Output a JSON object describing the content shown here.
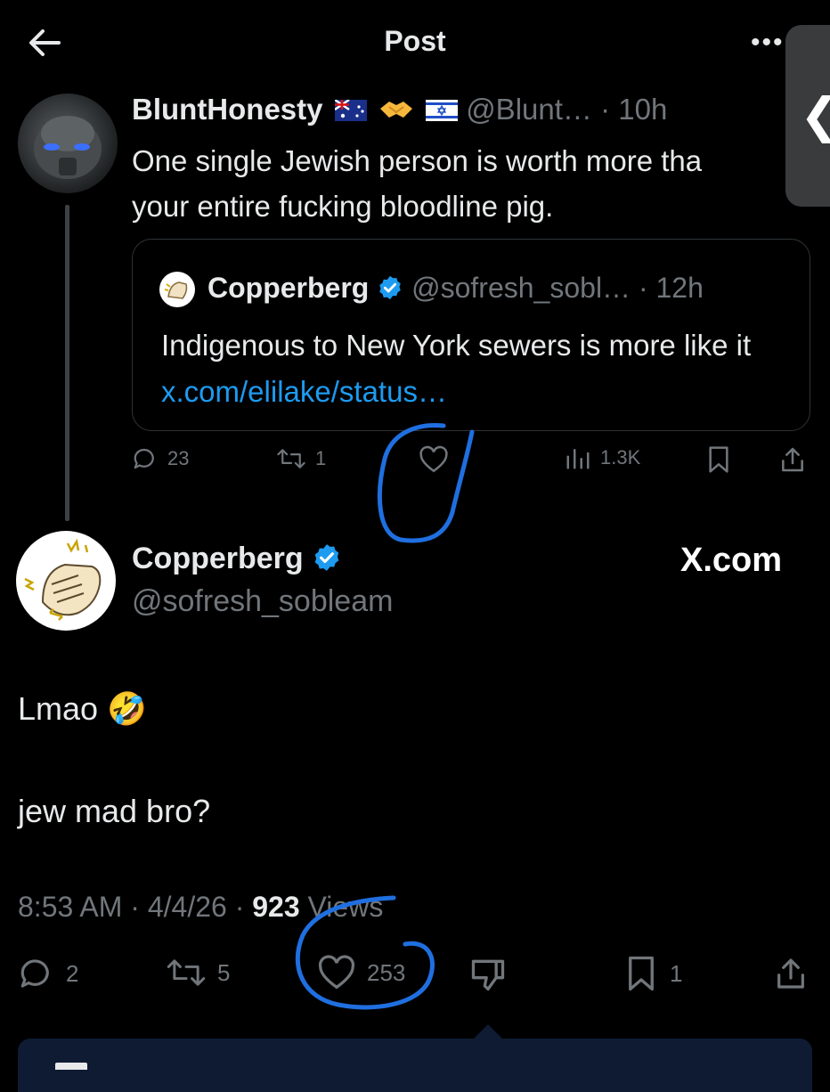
{
  "header": {
    "title": "Post",
    "back_icon": "arrow-left-icon",
    "more_label": "•••"
  },
  "side_tab": {
    "chevron": "❮"
  },
  "parent_post": {
    "display_name": "BluntHonesty",
    "handle": "@Blunt…",
    "time": "· 10h",
    "flags": [
      "australia-flag-icon",
      "handshake-icon",
      "israel-flag-icon"
    ],
    "text_line1": "One single Jewish person is worth more tha",
    "text_line2": "your entire fucking bloodline pig.",
    "quote": {
      "display_name": "Copperberg",
      "handle": "@sofresh_sobl…",
      "time": "· 12h",
      "text": "Indigenous to New York sewers is more like it ",
      "link": "x.com/elilake/status…"
    },
    "actions": {
      "replies": "23",
      "reposts": "1",
      "views": "1.3K"
    }
  },
  "main_post": {
    "display_name": "Copperberg",
    "handle": "@sofresh_sobleam",
    "brand": "X.com",
    "line1": "Lmao 🤣",
    "line2": "jew mad bro?",
    "time": "8:53 AM",
    "date": "4/4/26",
    "views_count": "923",
    "views_label": "Views",
    "actions": {
      "replies": "2",
      "reposts": "5",
      "likes": "253",
      "bookmarks": "1"
    }
  },
  "colors": {
    "background": "#000000",
    "text": "#e7e9ea",
    "muted": "#71767b",
    "link": "#1d9bf0",
    "verified": "#1d9bf0",
    "annotation": "#1f6fe0"
  }
}
